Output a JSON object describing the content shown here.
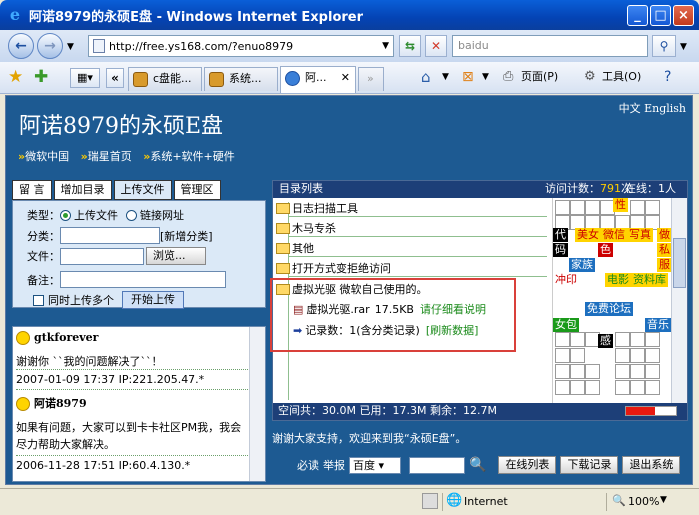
{
  "window": {
    "title": "阿诺8979的永硕E盘 - Windows Internet Explorer"
  },
  "navbar": {
    "url": "http://free.ys168.com/?enuo8979",
    "search_placeholder": "baidu"
  },
  "tabs": [
    {
      "label": "c盘能..."
    },
    {
      "label": "系统..."
    },
    {
      "label": "阿..."
    }
  ],
  "commands": {
    "page": "页面(P)",
    "tools": "工具(O)"
  },
  "header": {
    "title": "阿诺8979的永硕E盘",
    "lang": "中文 English"
  },
  "nav": [
    "微软中国",
    "瑞星首页",
    "系统+软件+硬件"
  ],
  "left_tabs": [
    "留 言",
    "增加目录",
    "上传文件",
    "管理区"
  ],
  "upload": {
    "type_label": "类型：",
    "radio_upload": "上传文件",
    "radio_link": "链接网址",
    "category_label": "分类：",
    "new_category": "[新增分类]",
    "file_label": "文件：",
    "browse": "浏览...",
    "note_label": "备注：",
    "multi": "同时上传多个",
    "start": "开始上传"
  },
  "guestbook": [
    {
      "user": "gtkforever",
      "text": "谢谢你 ``我的问题解决了``！",
      "meta": "2007-01-09 17:37 IP:221.205.47.*"
    },
    {
      "user": "阿诺8979",
      "text": "如果有问题，大家可以到卡卡社区PM我，我会尽力帮助大家解决。",
      "meta": "2006-11-28 17:51 IP:60.4.130.*"
    }
  ],
  "dirlist": {
    "title": "目录列表",
    "visits_label": "访问计数：",
    "visits": "791",
    "visits_unit": "次",
    "online": "在线：1人",
    "folders": [
      "日志扫描工具",
      "木马专杀",
      "其他",
      "打开方式变拒绝访问",
      "虚拟光驱 微软自己使用的。"
    ],
    "file": {
      "name": "虚拟光驱.rar",
      "size": "17.5KB",
      "note": "请仔细看说明"
    },
    "records": "记录数：1(含分类记录)",
    "refresh": "[刷新数据]",
    "space": "空间共：30.0M 已用：17.3M 剩余：12.7M",
    "used_fraction": 0.58
  },
  "ads": {
    "xing": "性",
    "dai": "代",
    "ma": "码",
    "meinv": "美女",
    "weixin": "微信",
    "xiezhen": "写真",
    "zuo": "做",
    "si": "私",
    "fu": "服",
    "se": "色",
    "jiazu": "家族",
    "chongyin": "冲印",
    "dianying": "电影",
    "ziliaoku": "资料库",
    "mianfei": "免费论坛",
    "nvbao": "女包",
    "yinyue": "音乐",
    "gan": "感"
  },
  "welcome": "谢谢大家支持，欢迎来到我“永硕E盘”。",
  "bottom": {
    "must_read": "必读",
    "report": "举报",
    "engine": "百度",
    "online_list": "在线列表",
    "download_log": "下载记录",
    "logout": "退出系统"
  },
  "status": {
    "zone": "Internet",
    "zoom": "100%"
  }
}
